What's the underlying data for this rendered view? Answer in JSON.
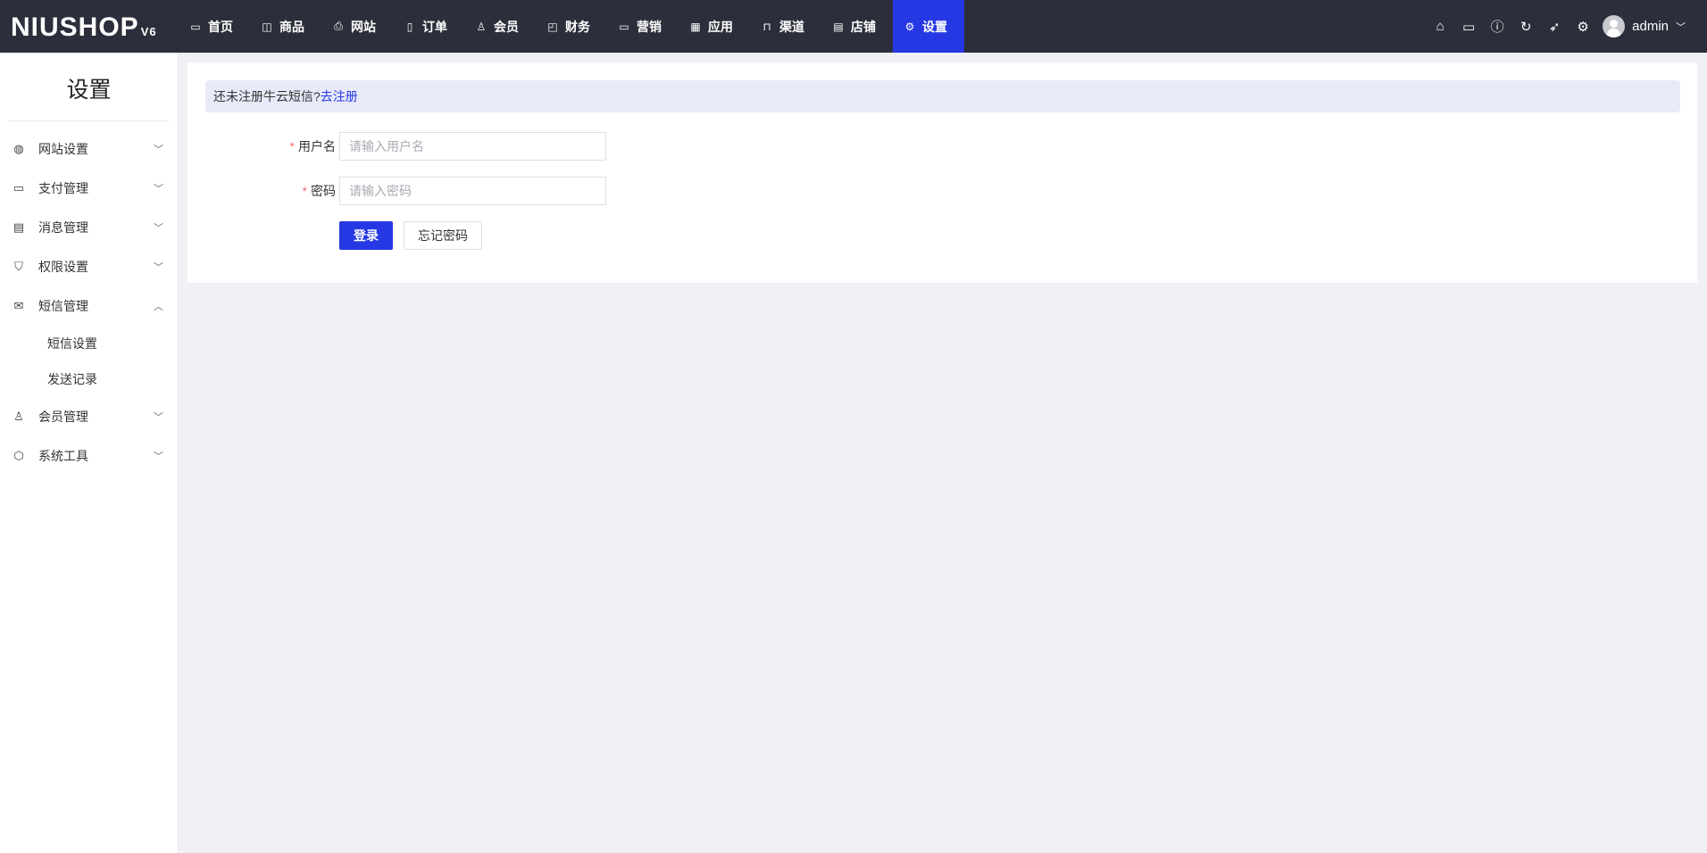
{
  "header": {
    "logo": "NIUSHOP",
    "logo_version": "V6",
    "nav": [
      {
        "label": "首页",
        "icon": "monitor-icon"
      },
      {
        "label": "商品",
        "icon": "box-icon"
      },
      {
        "label": "网站",
        "icon": "site-icon"
      },
      {
        "label": "订单",
        "icon": "clipboard-icon"
      },
      {
        "label": "会员",
        "icon": "user-icon"
      },
      {
        "label": "财务",
        "icon": "finance-icon"
      },
      {
        "label": "营销",
        "icon": "marketing-icon"
      },
      {
        "label": "应用",
        "icon": "app-icon"
      },
      {
        "label": "渠道",
        "icon": "channel-icon"
      },
      {
        "label": "店铺",
        "icon": "store-icon"
      },
      {
        "label": "设置",
        "icon": "gear-icon",
        "active": true
      }
    ],
    "user": "admin"
  },
  "sidebar": {
    "title": "设置",
    "items": [
      {
        "label": "网站设置"
      },
      {
        "label": "支付管理"
      },
      {
        "label": "消息管理"
      },
      {
        "label": "权限设置"
      },
      {
        "label": "短信管理",
        "expanded": true,
        "children": [
          {
            "label": "短信设置"
          },
          {
            "label": "发送记录"
          }
        ]
      },
      {
        "label": "会员管理"
      },
      {
        "label": "系统工具"
      }
    ]
  },
  "main": {
    "notice_text": "还未注册牛云短信?",
    "notice_link": "去注册",
    "username_label": "用户名",
    "username_placeholder": "请输入用户名",
    "password_label": "密码",
    "password_placeholder": "请输入密码",
    "required_mark": "*",
    "login_button": "登录",
    "forgot_button": "忘记密码"
  },
  "colors": {
    "header_bg": "#2c2f3b",
    "accent": "#2638e3",
    "notice_bg": "#e8eafa"
  }
}
